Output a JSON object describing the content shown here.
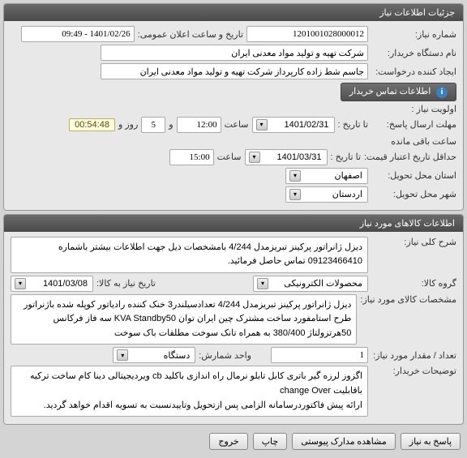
{
  "panels": {
    "details_title": "جزئیات اطلاعات نیاز",
    "items_title": "اطلاعات کالاهای مورد نیاز"
  },
  "details": {
    "need_number_label": "شماره نیاز:",
    "need_number": "1201001028000012",
    "announce_datetime_label": "تاریخ و ساعت اعلان عمومی:",
    "announce_datetime": "1401/02/26 - 09:49",
    "buyer_org_label": "نام دستگاه خریدار:",
    "buyer_org": "شرکت تهیه و تولید مواد معدنی ایران",
    "requester_label": "ایجاد کننده درخواست:",
    "requester": "جاسم شط زاده کارپرداز شرکت تهیه و تولید مواد معدنی ایران",
    "contact_button": "اطلاعات تماس خریدار",
    "priority_label": "اولویت نیاز :",
    "reply_deadline_label": "مهلت ارسال پاسخ:",
    "to_date_label": "تا تاریخ :",
    "reply_to_date": "1401/02/31",
    "time_label": "ساعت",
    "reply_time": "12:00",
    "and_label": "و",
    "days_remaining": "5",
    "days_label": "روز و",
    "timer": "00:54:48",
    "remaining_label": "ساعت باقی مانده",
    "price_validity_label": "حداقل تاریخ اعتبار قیمت:",
    "price_to_date": "1401/03/31",
    "price_time": "15:00",
    "delivery_state_label": "استان محل تحویل:",
    "delivery_state": "اصفهان",
    "delivery_city_label": "شهر محل تحویل:",
    "delivery_city": "اردستان"
  },
  "items": {
    "general_desc_label": "شرح کلی نیاز:",
    "general_desc": "دیزل ژانراتور پرکینز تبریزمدل 4/244 بامشخصات ذیل جهت اطلاعات بیشتر باشماره 09123466410 تماس حاصل فرمائید.",
    "group_label": "گروه کالا:",
    "group": "محصولات الکترونیکی",
    "need_by_label": "تاریخ نیاز به کالا:",
    "need_by": "1401/03/08",
    "spec_label": "مشخصات کالای مورد نیاز:",
    "spec": "دیزل ژانراتور پرکینز تبریزمدل 4/244 تعدادسیلندر3 خنک کننده رادیاتور کوپله شده باژنراتور طرح استامفورد ساخت مشترک چین ایران توان KVA Standby50 سه فاز فرکانس 50هرتزولتاژ 380/400 به همراه تانک سوخت مطلقات باک سوخت",
    "qty_label": "تعداد / مقدار مورد نیاز:",
    "qty": "1",
    "unit_label": "واحد شمارش:",
    "unit": "دستگاه",
    "buyer_notes_label": "توضیحات خریدار:",
    "buyer_notes": "اگزوز لرزه گیر باتری کابل تابلو نرمال راه اندازی باکلید cb ویردیجیتالی دینا کام ساخت ترکیه باقابلیت change Over\nارائه پیش فاکتوردرسامانه الزامی پس ازتحویل وتاییدنسبت به تسویه اقدام خواهد گردید."
  },
  "footer": {
    "reply": "پاسخ به نیاز",
    "attachments": "مشاهده مدارک پیوستی",
    "print": "چاپ",
    "exit": "خروج"
  }
}
